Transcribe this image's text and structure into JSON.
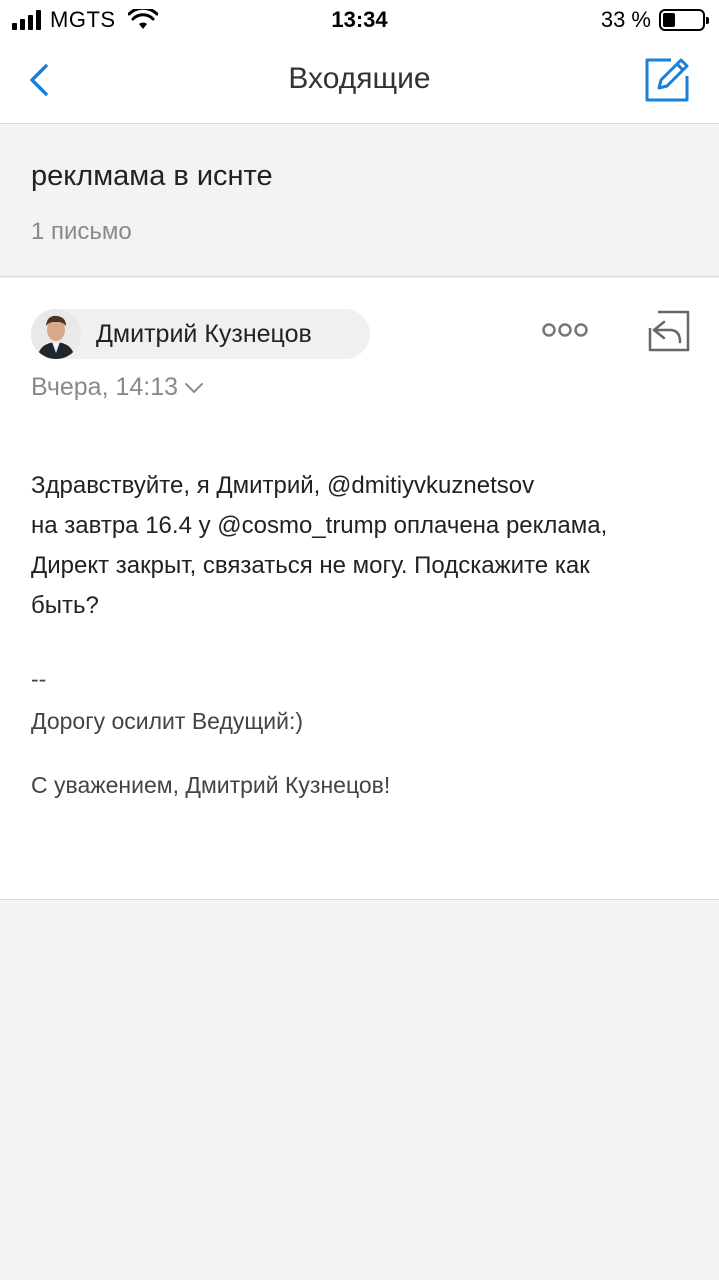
{
  "status_bar": {
    "carrier": "MGTS",
    "time": "13:34",
    "battery": "33 %",
    "battery_level": 0.33
  },
  "nav": {
    "title": "Входящие",
    "back_icon": "chevron-left-icon",
    "compose_icon": "compose-icon"
  },
  "thread": {
    "subject": "реклмама в иснте",
    "count": "1 письмо"
  },
  "message": {
    "sender": "Дмитрий Кузнецов",
    "date": "Вчера, 14:13",
    "body_lines": [
      "Здравствуйте, я Дмитрий, @dmitiyvkuznetsov",
      "на завтра 16.4 у @cosmo_trump оплачена реклама,",
      "Директ закрыт, связаться не могу. Подскажите как",
      "быть?"
    ],
    "sig_dash": "--",
    "sig_line1": "Дорогу осилит Ведущий:)",
    "sig_line2": "С уважением, Дмитрий Кузнецов!"
  },
  "colors": {
    "accent": "#1a7fd6",
    "background": "#f4f3f1",
    "secondary_text": "#8a8a8a"
  }
}
